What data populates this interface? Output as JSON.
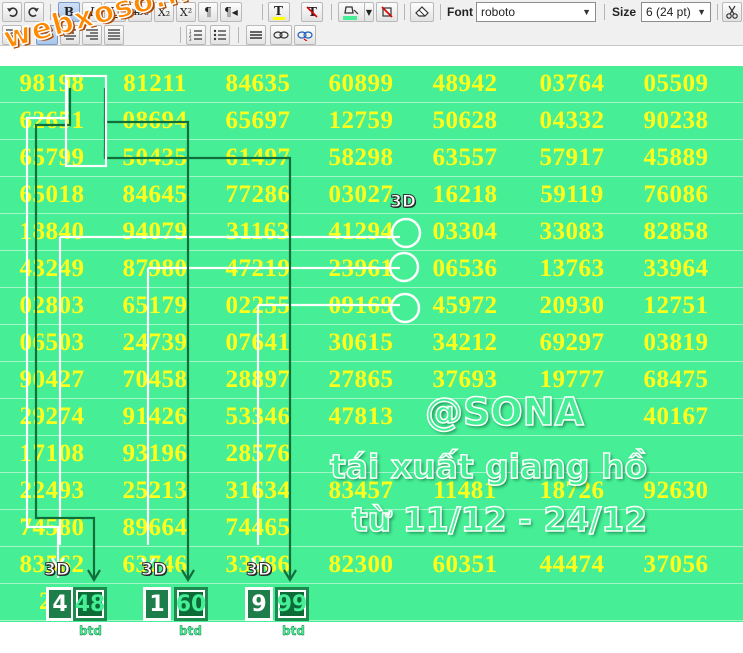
{
  "toolbar": {
    "font_label": "Font",
    "font_value": "roboto",
    "size_label": "Size",
    "size_value": "6 (24 pt)",
    "colors": {
      "text": "#ffff00",
      "highlight": "#46ef96"
    },
    "buttons": [
      {
        "name": "undo-button",
        "icon": "undo-icon"
      },
      {
        "name": "redo-button",
        "icon": "redo-icon"
      },
      {
        "name": "bold-button",
        "label": "B"
      },
      {
        "name": "italic-button",
        "label": "I"
      },
      {
        "name": "underline-button",
        "label": "U"
      },
      {
        "name": "strikethrough-button",
        "label": "abc"
      },
      {
        "name": "subscript-button",
        "label": "X₂"
      },
      {
        "name": "superscript-button",
        "label": "X²"
      },
      {
        "name": "ltr-button",
        "label": "¶"
      },
      {
        "name": "rtl-button",
        "label": "¶◂"
      }
    ]
  },
  "grid": {
    "rows": [
      [
        "98198",
        "81211",
        "84635",
        "60899",
        "48942",
        "03764",
        "05509"
      ],
      [
        "62651",
        "08694",
        "65697",
        "12759",
        "50628",
        "04332",
        "90238"
      ],
      [
        "65799",
        "50435",
        "61497",
        "58298",
        "63557",
        "57917",
        "45889"
      ],
      [
        "65018",
        "84645",
        "77286",
        "03027",
        "16218",
        "59119",
        "76086"
      ],
      [
        "18840",
        "94079",
        "31163",
        "41294",
        "03304",
        "33083",
        "82858"
      ],
      [
        "43249",
        "87980",
        "47219",
        "23961",
        "06536",
        "13763",
        "33964"
      ],
      [
        "02803",
        "65179",
        "02255",
        "09169",
        "45972",
        "20930",
        "12751"
      ],
      [
        "06503",
        "24739",
        "07641",
        "30615",
        "34212",
        "69297",
        "03819"
      ],
      [
        "90427",
        "70458",
        "28897",
        "27865",
        "37693",
        "19777",
        "68475"
      ],
      [
        "29274",
        "91426",
        "53346",
        "47813",
        "",
        "",
        "40167"
      ],
      [
        "17108",
        "93196",
        "28576",
        "",
        "",
        "",
        ""
      ],
      [
        "22493",
        "25213",
        "31634",
        "83457",
        "11481",
        "18726",
        "92630"
      ],
      [
        "74580",
        "89664",
        "74465",
        "",
        "",
        "",
        ""
      ],
      [
        "83562",
        "63746",
        "33986",
        "82300",
        "60351",
        "44474",
        "37056"
      ],
      [
        "28",
        "61",
        "",
        "",
        "",
        "",
        ""
      ]
    ]
  },
  "overlay": {
    "logo": "webxoso.net",
    "promo_title": "@SONA",
    "promo_line2": "tái xuất giang hồ",
    "promo_line3": "từ 11/12 - 24/12",
    "label_3d": "3D",
    "groups": [
      {
        "digit": "4",
        "pair": "48",
        "tag": "btd"
      },
      {
        "digit": "1",
        "pair": "60",
        "tag": "btd"
      },
      {
        "digit": "9",
        "pair": "99",
        "tag": "btd"
      }
    ]
  }
}
